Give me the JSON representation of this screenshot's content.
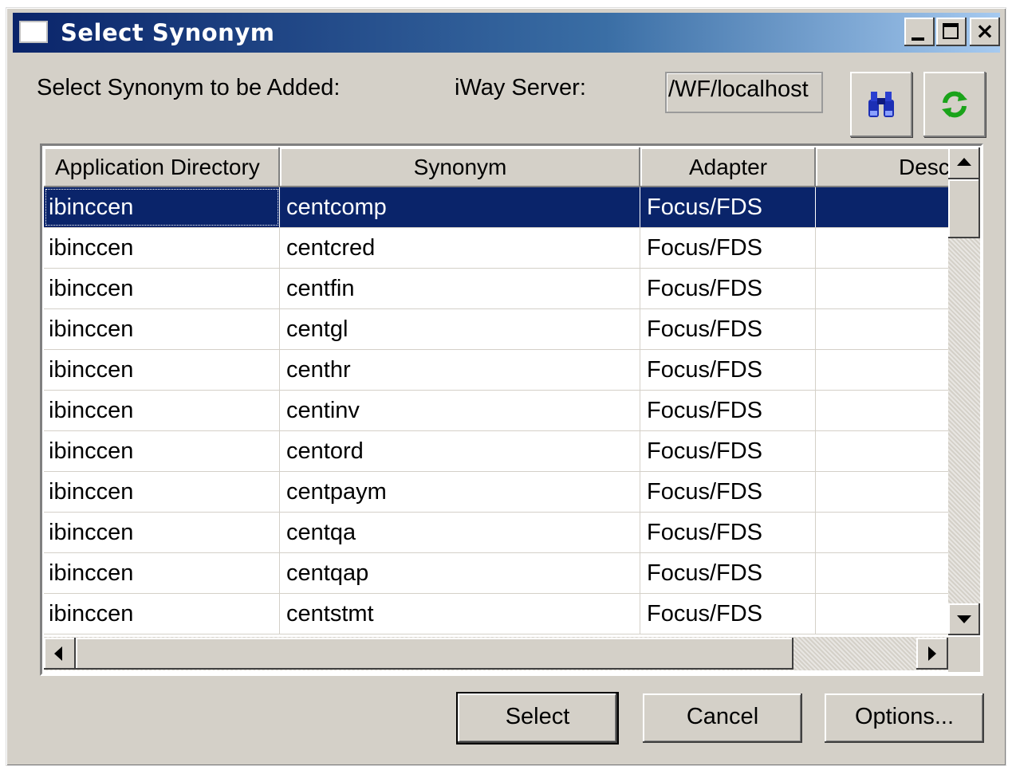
{
  "window": {
    "title": "Select Synonym",
    "minimize_label": "_",
    "maximize_label": "□",
    "close_label": "×"
  },
  "form": {
    "select_label": "Select Synonym to be Added:",
    "server_label": "iWay Server:",
    "server_value": "/WF/localhost"
  },
  "toolbar": {
    "find_icon": "binoculars-icon",
    "refresh_icon": "refresh-icon"
  },
  "table": {
    "columns": [
      "Application Directory",
      "Synonym",
      "Adapter",
      "Desc"
    ],
    "selected_row": 0,
    "rows": [
      [
        "ibinccen",
        "centcomp",
        "Focus/FDS",
        ""
      ],
      [
        "ibinccen",
        "centcred",
        "Focus/FDS",
        ""
      ],
      [
        "ibinccen",
        "centfin",
        "Focus/FDS",
        ""
      ],
      [
        "ibinccen",
        "centgl",
        "Focus/FDS",
        ""
      ],
      [
        "ibinccen",
        "centhr",
        "Focus/FDS",
        ""
      ],
      [
        "ibinccen",
        "centinv",
        "Focus/FDS",
        ""
      ],
      [
        "ibinccen",
        "centord",
        "Focus/FDS",
        ""
      ],
      [
        "ibinccen",
        "centpaym",
        "Focus/FDS",
        ""
      ],
      [
        "ibinccen",
        "centqa",
        "Focus/FDS",
        ""
      ],
      [
        "ibinccen",
        "centqap",
        "Focus/FDS",
        ""
      ],
      [
        "ibinccen",
        "centstmt",
        "Focus/FDS",
        ""
      ]
    ]
  },
  "buttons": {
    "select_label": "Select",
    "cancel_label": "Cancel",
    "options_label": "Options..."
  },
  "colors": {
    "titlebar_start": "#0a246a",
    "titlebar_end": "#a6caf0",
    "selection": "#0a246a",
    "face": "#d4d0c8"
  }
}
